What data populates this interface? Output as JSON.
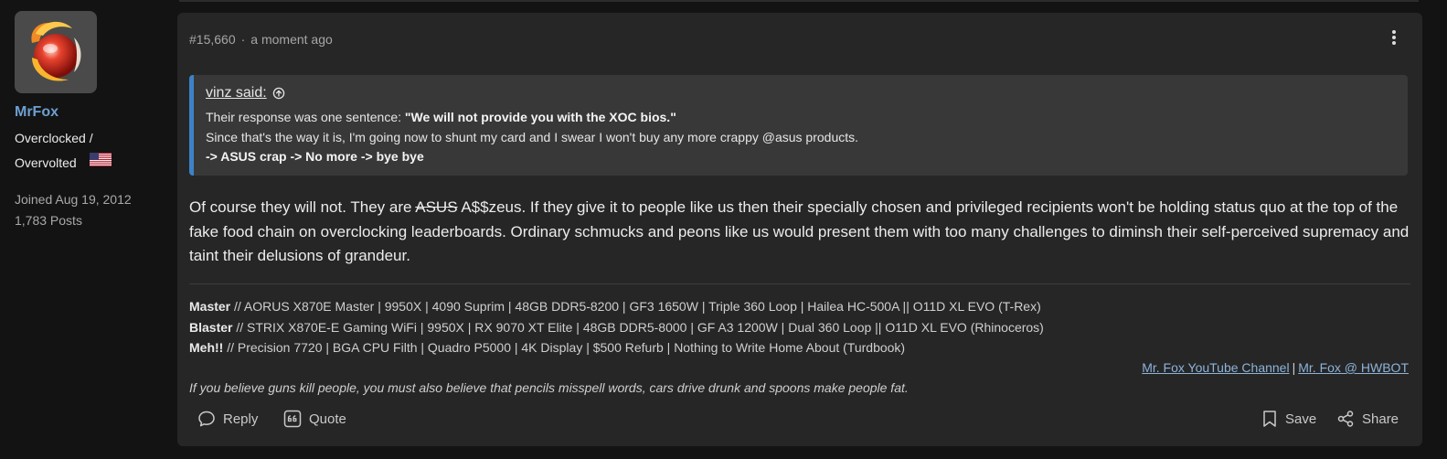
{
  "user": {
    "name": "MrFox",
    "title_line1": "Overclocked /",
    "title_line2": "Overvolted",
    "flag": "us-flag-icon",
    "joined": "Joined Aug 19, 2012",
    "posts": "1,783 Posts"
  },
  "post": {
    "number": "#15,660",
    "separator": "·",
    "time": "a moment ago",
    "quote": {
      "author": "vinz said:",
      "line1_prefix": "Their response was one sentence: ",
      "line1_bold": "\"We will not provide you with the XOC bios.\"",
      "line2": "Since that's the way it is, I'm going now to shunt my card and I swear I won't buy any more crappy @asus products.",
      "line3": "-> ASUS crap -> No more -> bye bye"
    },
    "body_prefix": "Of course they will not. They are ",
    "body_strike": "ASUS",
    "body_rest": " A$$zeus. If they give it to people like us then their specially chosen and privileged recipients won't be holding status quo at the top of the fake food chain on overclocking leaderboards. Ordinary schmucks and peons like us would present them with too many challenges to diminsh their self-perceived supremacy and taint their delusions of grandeur."
  },
  "signature": {
    "rigs": [
      {
        "name": "Master",
        "spec": " // AORUS X870E Master | 9950X | 4090 Suprim | 48GB DDR5-8200 | GF3 1650W | Triple 360 Loop | Hailea HC-500A || O11D XL EVO (T-Rex)"
      },
      {
        "name": "Blaster",
        "spec": " // STRIX X870E-E Gaming WiFi | 9950X | RX 9070 XT Elite | 48GB DDR5-8000 | GF A3 1200W | Dual 360 Loop || O11D XL EVO (Rhinoceros)"
      },
      {
        "name": "Meh!!",
        "spec": " // Precision 7720 | BGA CPU Filth | Quadro P5000 | 4K Display | $500 Refurb | Nothing to Write Home About (Turdbook)"
      }
    ],
    "link1": "Mr. Fox YouTube Channel",
    "link_sep": "|",
    "link2": "Mr. Fox @ HWBOT",
    "quote": "If you believe guns kill people, you must also believe that pencils misspell words, cars drive drunk and spoons make people fat."
  },
  "actions": {
    "reply": "Reply",
    "quote": "Quote",
    "save": "Save",
    "share": "Share"
  },
  "colors": {
    "username": "#6e9fd1",
    "quote_accent": "#3d82c8",
    "link": "#8db3d9",
    "card_bg": "#262626",
    "page_bg": "#131313"
  }
}
